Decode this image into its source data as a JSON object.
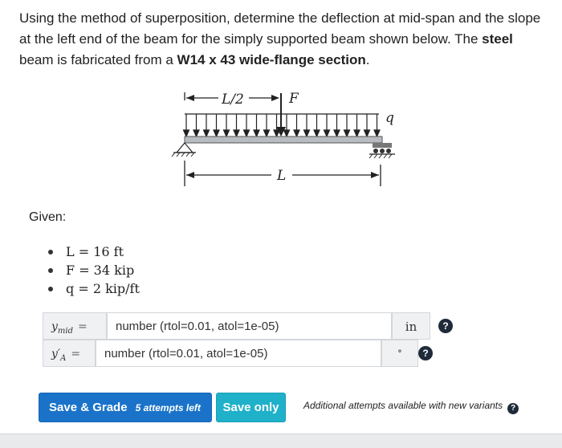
{
  "question": {
    "text_1": "Using the method of superposition, determine the deflection at mid-span and the slope at the left end of the beam for the simply supported beam shown below. The ",
    "bold_1": "steel",
    "text_2": " beam is fabricated from a ",
    "bold_2": "W14 x 43 wide-flange section",
    "text_3": "."
  },
  "diagram": {
    "label_half": "L/2",
    "label_F": "F",
    "label_q": "q",
    "label_L": "L"
  },
  "given": {
    "title": "Given:",
    "items": [
      "L = 16 ft",
      "F = 34 kip",
      "q = 2 kip/ft"
    ]
  },
  "answers": [
    {
      "lhs": "y",
      "lhs_sub": "mid",
      "eq": "=",
      "placeholder": "number (rtol=0.01, atol=1e-05)",
      "unit": "in",
      "help": "?"
    },
    {
      "lhs": "y′",
      "lhs_sub": "A",
      "eq": "=",
      "placeholder": "number (rtol=0.01, atol=1e-05)",
      "unit": "∘",
      "help": "?"
    }
  ],
  "actions": {
    "grade_label": "Save & Grade",
    "attempts_label": "5 attempts left",
    "save_label": "Save only",
    "note": "Additional attempts available with new variants",
    "note_help": "?"
  }
}
